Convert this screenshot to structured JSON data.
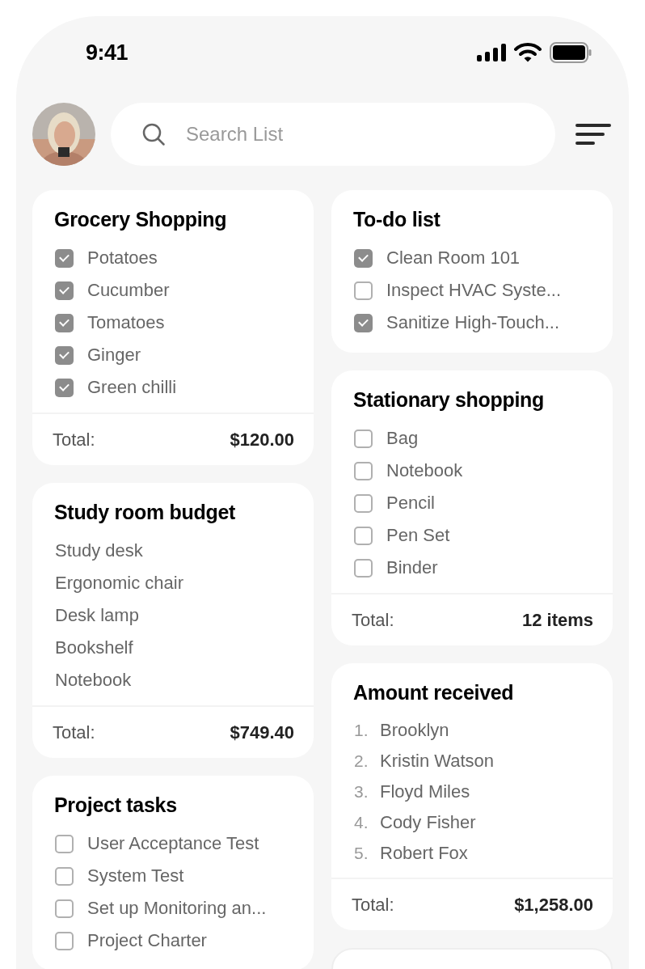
{
  "status_bar": {
    "time": "9:41"
  },
  "search": {
    "placeholder": "Search List"
  },
  "columns": [
    [
      {
        "kind": "checklist",
        "title": "Grocery Shopping",
        "items": [
          {
            "label": "Potatoes",
            "checked": true
          },
          {
            "label": "Cucumber",
            "checked": true
          },
          {
            "label": "Tomatoes",
            "checked": true
          },
          {
            "label": "Ginger",
            "checked": true
          },
          {
            "label": "Green chilli",
            "checked": true
          }
        ],
        "footer": {
          "label": "Total:",
          "value": "$120.00"
        }
      },
      {
        "kind": "plain",
        "title": "Study room budget",
        "items": [
          {
            "label": "Study desk"
          },
          {
            "label": "Ergonomic chair"
          },
          {
            "label": "Desk lamp"
          },
          {
            "label": "Bookshelf"
          },
          {
            "label": "Notebook"
          }
        ],
        "footer": {
          "label": "Total:",
          "value": "$749.40"
        }
      },
      {
        "kind": "checklist",
        "title": "Project tasks",
        "items": [
          {
            "label": "User Acceptance Test",
            "checked": false
          },
          {
            "label": "System Test",
            "checked": false
          },
          {
            "label": "Set up Monitoring an...",
            "checked": false
          },
          {
            "label": "Project Charter",
            "checked": false
          }
        ]
      }
    ],
    [
      {
        "kind": "checklist",
        "title": "To-do list",
        "items": [
          {
            "label": "Clean Room 101",
            "checked": true
          },
          {
            "label": "Inspect HVAC Syste...",
            "checked": false
          },
          {
            "label": "Sanitize High-Touch...",
            "checked": true
          }
        ]
      },
      {
        "kind": "checklist",
        "title": "Stationary shopping",
        "items": [
          {
            "label": "Bag",
            "checked": false
          },
          {
            "label": "Notebook",
            "checked": false
          },
          {
            "label": "Pencil",
            "checked": false
          },
          {
            "label": "Pen Set",
            "checked": false
          },
          {
            "label": "Binder",
            "checked": false
          }
        ],
        "footer": {
          "label": "Total:",
          "value": "12 items"
        }
      },
      {
        "kind": "numbered",
        "title": "Amount received",
        "items": [
          {
            "number": "1.",
            "label": "Brooklyn"
          },
          {
            "number": "2.",
            "label": "Kristin Watson"
          },
          {
            "number": "3.",
            "label": "Floyd Miles"
          },
          {
            "number": "4.",
            "label": "Cody Fisher"
          },
          {
            "number": "5.",
            "label": "Robert Fox"
          }
        ],
        "footer": {
          "label": "Total:",
          "value": "$1,258.00"
        }
      },
      {
        "kind": "blank"
      }
    ]
  ]
}
